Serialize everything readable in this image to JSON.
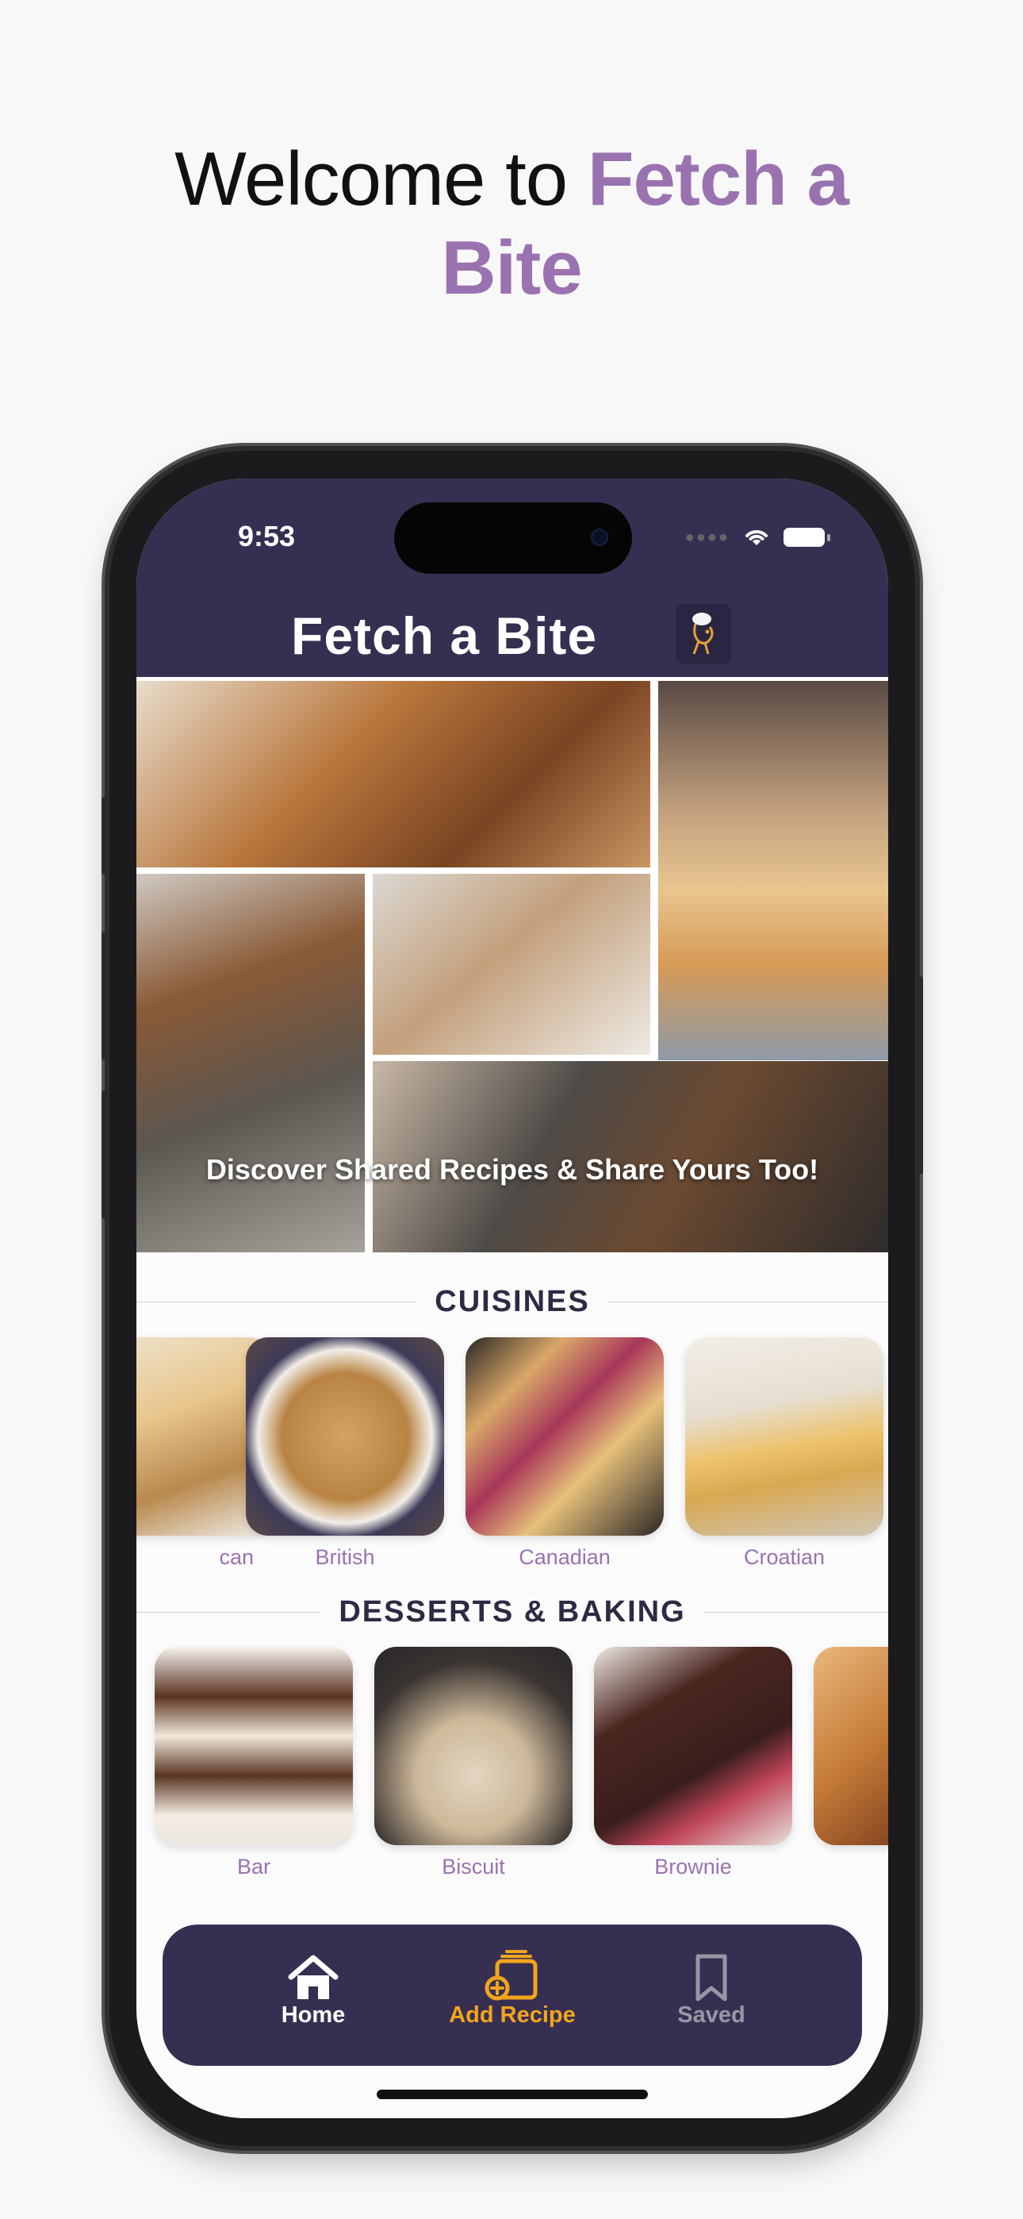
{
  "headline": {
    "prefix": "Welcome to ",
    "accent_line1": "Fetch a",
    "accent_line2": "Bite"
  },
  "status_bar": {
    "time": "9:53"
  },
  "app_header": {
    "title": "Fetch a Bite"
  },
  "hero": {
    "caption": "Discover Shared Recipes & Share Yours Too!"
  },
  "cuisines": {
    "title": "CUISINES",
    "items": [
      {
        "label": "can"
      },
      {
        "label": "British"
      },
      {
        "label": "Canadian"
      },
      {
        "label": "Croatian"
      }
    ]
  },
  "desserts": {
    "title": "DESSERTS & BAKING",
    "items": [
      {
        "label": "Bar"
      },
      {
        "label": "Biscuit"
      },
      {
        "label": "Brownie"
      },
      {
        "label": ""
      }
    ]
  },
  "navbar": {
    "items": [
      {
        "label": "Home",
        "icon": "home-icon"
      },
      {
        "label": "Add Recipe",
        "icon": "add-recipe-icon",
        "active": true
      },
      {
        "label": "Saved",
        "icon": "bookmark-icon"
      }
    ]
  },
  "colors": {
    "brand_dark": "#372f52",
    "accent_purple": "#9b72b0",
    "active_orange": "#f2a51c",
    "inactive_gray": "#9a97a5"
  }
}
